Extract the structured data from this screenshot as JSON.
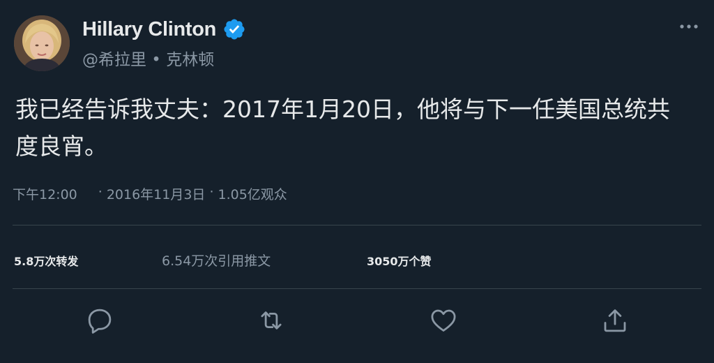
{
  "tweet": {
    "display_name": "Hillary Clinton",
    "handle": "@希拉里 • 克林顿",
    "text": "我已经告诉我丈夫：2017年1月20日，他将与下一任美国总统共度良宵。",
    "time": "下午12:00",
    "date": "2016年11月3日",
    "views": "1.05亿观众",
    "separator": "·"
  },
  "stats": {
    "retweets": "5.8万次转发",
    "quotes": "6.54万次引用推文",
    "likes": "3050万个赞"
  },
  "icons": {
    "verified": "verified-badge-icon",
    "more": "more-options-icon",
    "reply": "reply-icon",
    "retweet": "retweet-icon",
    "like": "heart-icon",
    "share": "share-icon"
  },
  "colors": {
    "background": "#15202b",
    "verified": "#1d9bf0",
    "muted": "#8b98a5",
    "text": "#e7e9ea"
  }
}
